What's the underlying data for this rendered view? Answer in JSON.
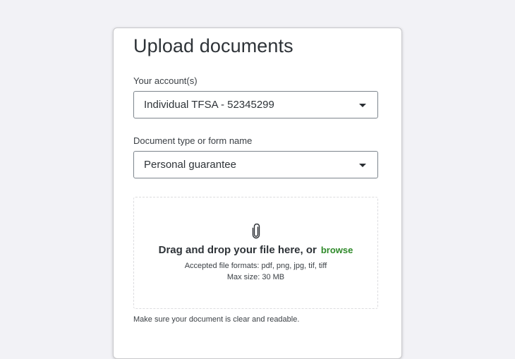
{
  "page": {
    "title": "Upload documents"
  },
  "account": {
    "label": "Your account(s)",
    "value": "Individual TFSA - 52345299"
  },
  "document_type": {
    "label": "Document type or form name",
    "value": "Personal guarantee"
  },
  "dropzone": {
    "icon": "paperclip-icon",
    "main_text": "Drag and drop your file here, or",
    "browse_label": "browse",
    "formats_text": "Accepted file formats: pdf, png, jpg, tif, tiff",
    "max_size_text": "Max size: 30 MB"
  },
  "note": "Make sure your document is clear and readable.",
  "colors": {
    "accent_link": "#2f8a2a",
    "text": "#2e3338",
    "background": "#f2f2f6"
  }
}
